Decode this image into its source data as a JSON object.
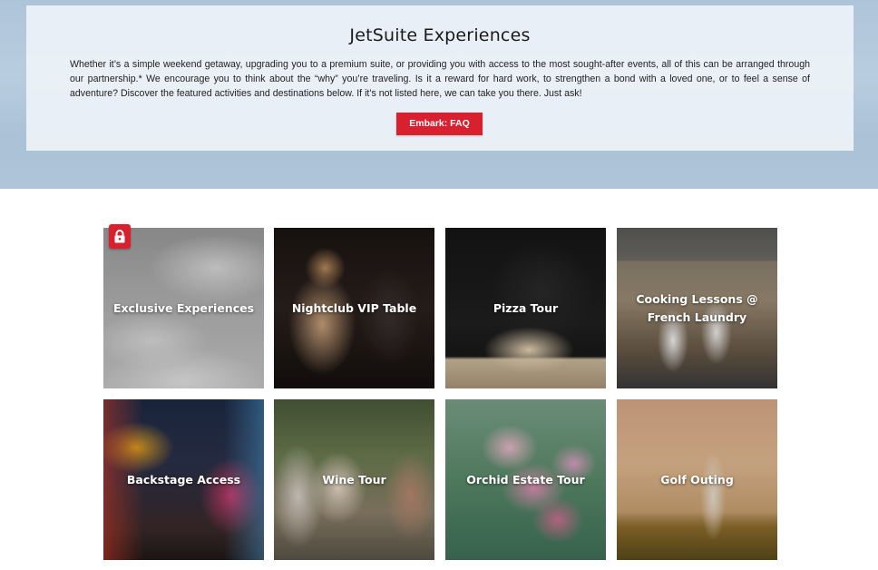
{
  "intro": {
    "title": "JetSuite Experiences",
    "body": "Whether it’s a simple weekend getaway, upgrading you to a premium suite, or providing you with access to the most sought-after events, all of this can be arranged through our partnership.* We encourage you to think about the “why” you’re traveling. Is it a reward for hard work, to strengthen a bond with a loved one, or to feel a sense of adventure? Discover the featured activities and destinations below. If it’s not listed here, we can take you there. Just ask!",
    "button_label": "Embark: FAQ"
  },
  "colors": {
    "accent": "#d8202f",
    "panel": "#edf2f7"
  },
  "experiences": [
    {
      "label": "Exclusive Experiences",
      "icon": "lock-icon",
      "locked": true
    },
    {
      "label": "Nightclub VIP Table"
    },
    {
      "label": "Pizza Tour"
    },
    {
      "label": "Cooking Lessons @ French Laundry"
    },
    {
      "label": "Backstage Access"
    },
    {
      "label": "Wine Tour"
    },
    {
      "label": "Orchid Estate Tour"
    },
    {
      "label": "Golf Outing"
    }
  ]
}
